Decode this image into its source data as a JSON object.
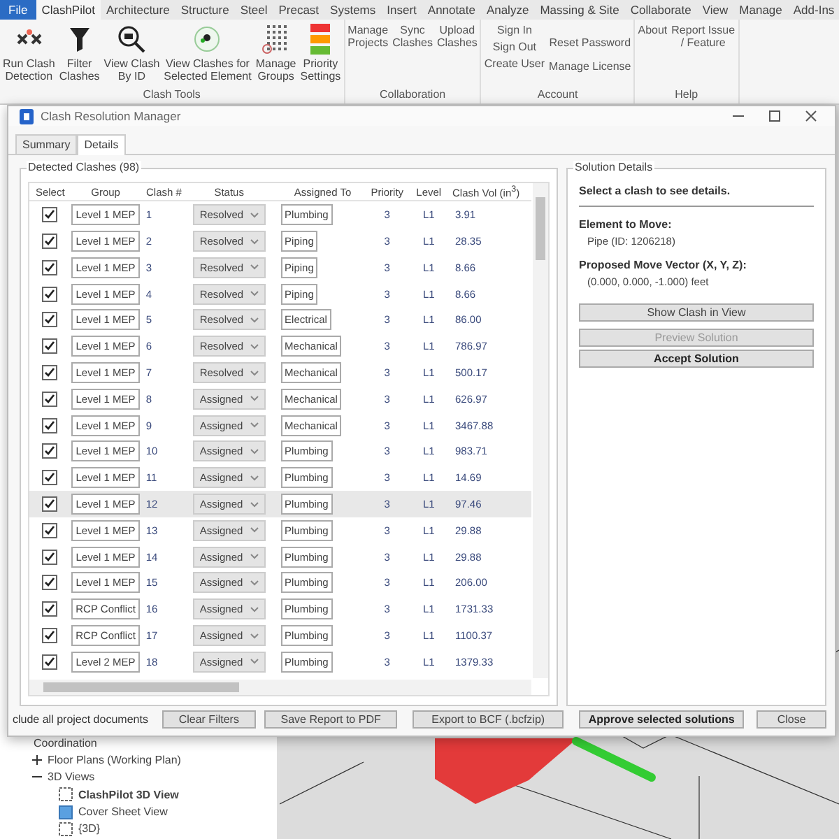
{
  "ribbon": {
    "tabs": [
      {
        "label": "File",
        "kind": "file",
        "selected": false
      },
      {
        "label": "ClashPilot",
        "kind": "tab",
        "selected": true
      },
      {
        "label": "Architecture",
        "kind": "tab",
        "selected": false
      },
      {
        "label": "Structure",
        "kind": "tab",
        "selected": false
      },
      {
        "label": "Steel",
        "kind": "tab",
        "selected": false
      },
      {
        "label": "Precast",
        "kind": "tab",
        "selected": false
      },
      {
        "label": "Systems",
        "kind": "tab",
        "selected": false
      },
      {
        "label": "Insert",
        "kind": "tab",
        "selected": false
      },
      {
        "label": "Annotate",
        "kind": "tab",
        "selected": false
      },
      {
        "label": "Analyze",
        "kind": "tab",
        "selected": false
      },
      {
        "label": "Massing & Site",
        "kind": "tab",
        "selected": false
      },
      {
        "label": "Collaborate",
        "kind": "tab",
        "selected": false
      },
      {
        "label": "View",
        "kind": "tab",
        "selected": false
      },
      {
        "label": "Manage",
        "kind": "tab",
        "selected": false
      },
      {
        "label": "Add-Ins",
        "kind": "tab",
        "selected": false
      }
    ],
    "panels": [
      {
        "title": "Clash Tools",
        "columns": [
          [
            {
              "label": "Run Clash\nDetection",
              "kind": "detect"
            }
          ],
          [
            {
              "label": "Filter\nClashes",
              "kind": "filter"
            }
          ],
          [
            {
              "label": "View Clash\nBy ID",
              "kind": "id"
            }
          ],
          [
            {
              "label": "View Clashes for\nSelected Element",
              "kind": "element"
            }
          ],
          [
            {
              "label": "Manage\nGroups",
              "kind": "groups"
            }
          ],
          [
            {
              "label": "Priority\nSettings",
              "kind": "priority"
            }
          ]
        ]
      },
      {
        "title": "Collaboration",
        "columns": [
          [
            {
              "label": "Manage\nProjects",
              "kind": "text"
            }
          ],
          [
            {
              "label": "Sync\nClashes",
              "kind": "text"
            }
          ],
          [
            {
              "label": "Upload\nClashes",
              "kind": "text"
            }
          ]
        ]
      },
      {
        "title": "Account",
        "columns": [
          [
            {
              "label": "Sign In",
              "kind": "text"
            },
            {
              "label": "Sign Out",
              "kind": "text"
            },
            {
              "label": "Create User",
              "kind": "text"
            }
          ],
          [
            {
              "label": "Reset Password",
              "kind": "text"
            },
            {
              "label": "Manage License",
              "kind": "text"
            }
          ]
        ]
      },
      {
        "title": "Help",
        "columns": [
          [
            {
              "label": "About",
              "kind": "text"
            }
          ],
          [
            {
              "label": "Report Issue\n/ Feature",
              "kind": "text"
            }
          ]
        ]
      }
    ]
  },
  "browser": {
    "items": [
      {
        "label": "Coordination",
        "children": [
          {
            "label": "Floor Plans (Working Plan)",
            "expanded": false
          },
          {
            "label": "3D Views",
            "expanded": true,
            "children": [
              {
                "label": "ClashPilot 3D View",
                "kind": "view",
                "selected": true
              },
              {
                "label": "Cover Sheet View",
                "kind": "sheet",
                "selected": false
              },
              {
                "label": "{3D}",
                "kind": "view",
                "selected": false
              }
            ]
          }
        ]
      }
    ]
  },
  "dialog": {
    "title": "Clash Resolution Manager",
    "tabs": [
      {
        "label": "Summary",
        "selected": false
      },
      {
        "label": "Details",
        "selected": true
      }
    ],
    "clashes": {
      "legend": "Detected Clashes (98)",
      "columns": [
        "Select",
        "Group",
        "Clash #",
        "Status",
        "Assigned To",
        "Priority",
        "Level",
        "Clash Vol (in$^{3}$)"
      ],
      "rows": [
        {
          "checked": true,
          "group": "Level 1 MEP",
          "number": "1",
          "status": "Resolved",
          "assigned_to": "Plumbing",
          "priority": "3",
          "level": "L1",
          "volume": "3.91",
          "selected": false
        },
        {
          "checked": true,
          "group": "Level 1 MEP",
          "number": "2",
          "status": "Resolved",
          "assigned_to": "Piping",
          "priority": "3",
          "level": "L1",
          "volume": "28.35",
          "selected": false
        },
        {
          "checked": true,
          "group": "Level 1 MEP",
          "number": "3",
          "status": "Resolved",
          "assigned_to": "Piping",
          "priority": "3",
          "level": "L1",
          "volume": "8.66",
          "selected": false
        },
        {
          "checked": true,
          "group": "Level 1 MEP",
          "number": "4",
          "status": "Resolved",
          "assigned_to": "Piping",
          "priority": "3",
          "level": "L1",
          "volume": "8.66",
          "selected": false
        },
        {
          "checked": true,
          "group": "Level 1 MEP",
          "number": "5",
          "status": "Resolved",
          "assigned_to": "Electrical",
          "priority": "3",
          "level": "L1",
          "volume": "86.00",
          "selected": false
        },
        {
          "checked": true,
          "group": "Level 1 MEP",
          "number": "6",
          "status": "Resolved",
          "assigned_to": "Mechanical",
          "priority": "3",
          "level": "L1",
          "volume": "786.97",
          "selected": false
        },
        {
          "checked": true,
          "group": "Level 1 MEP",
          "number": "7",
          "status": "Resolved",
          "assigned_to": "Mechanical",
          "priority": "3",
          "level": "L1",
          "volume": "500.17",
          "selected": false
        },
        {
          "checked": true,
          "group": "Level 1 MEP",
          "number": "8",
          "status": "Assigned",
          "assigned_to": "Mechanical",
          "priority": "3",
          "level": "L1",
          "volume": "626.97",
          "selected": false
        },
        {
          "checked": true,
          "group": "Level 1 MEP",
          "number": "9",
          "status": "Assigned",
          "assigned_to": "Mechanical",
          "priority": "3",
          "level": "L1",
          "volume": "3467.88",
          "selected": false
        },
        {
          "checked": true,
          "group": "Level 1 MEP",
          "number": "10",
          "status": "Assigned",
          "assigned_to": "Plumbing",
          "priority": "3",
          "level": "L1",
          "volume": "983.71",
          "selected": false
        },
        {
          "checked": true,
          "group": "Level 1 MEP",
          "number": "11",
          "status": "Assigned",
          "assigned_to": "Plumbing",
          "priority": "3",
          "level": "L1",
          "volume": "14.69",
          "selected": false
        },
        {
          "checked": true,
          "group": "Level 1 MEP",
          "number": "12",
          "status": "Assigned",
          "assigned_to": "Plumbing",
          "priority": "3",
          "level": "L1",
          "volume": "97.46",
          "selected": true
        },
        {
          "checked": true,
          "group": "Level 1 MEP",
          "number": "13",
          "status": "Assigned",
          "assigned_to": "Plumbing",
          "priority": "3",
          "level": "L1",
          "volume": "29.88",
          "selected": false
        },
        {
          "checked": true,
          "group": "Level 1 MEP",
          "number": "14",
          "status": "Assigned",
          "assigned_to": "Plumbing",
          "priority": "3",
          "level": "L1",
          "volume": "29.88",
          "selected": false
        },
        {
          "checked": true,
          "group": "Level 1 MEP",
          "number": "15",
          "status": "Assigned",
          "assigned_to": "Plumbing",
          "priority": "3",
          "level": "L1",
          "volume": "206.00",
          "selected": false
        },
        {
          "checked": true,
          "group": "RCP Conflict",
          "number": "16",
          "status": "Assigned",
          "assigned_to": "Plumbing",
          "priority": "3",
          "level": "L1",
          "volume": "1731.33",
          "selected": false
        },
        {
          "checked": true,
          "group": "RCP Conflict",
          "number": "17",
          "status": "Assigned",
          "assigned_to": "Plumbing",
          "priority": "3",
          "level": "L1",
          "volume": "1100.37",
          "selected": false
        },
        {
          "checked": true,
          "group": "Level 2 MEP",
          "number": "18",
          "status": "Assigned",
          "assigned_to": "Plumbing",
          "priority": "3",
          "level": "L1",
          "volume": "1379.33",
          "selected": false
        }
      ]
    },
    "solution": {
      "legend": "Solution Details",
      "prompt": "Select a clash to see details.",
      "element_label": "Element to Move:",
      "element_value": "Pipe (ID: 1206218)",
      "vector_label": "Proposed Move Vector (X, Y, Z):",
      "vector_value": "(0.000, 0.000, -1.000) feet",
      "buttons": [
        {
          "label": "Show Clash in View",
          "kind": "normal",
          "disabled": false
        },
        {
          "label": "Preview Solution",
          "kind": "normal",
          "disabled": true
        },
        {
          "label": "Accept Solution",
          "kind": "strong",
          "disabled": false
        }
      ]
    },
    "footer": {
      "option_text": "clude all project documents",
      "buttons": [
        {
          "label": "Clear Filters",
          "kind": "normal"
        },
        {
          "label": "Save Report to PDF",
          "kind": "normal"
        },
        {
          "label": "Export to BCF (.bcfzip)",
          "kind": "normal"
        },
        {
          "label": "Approve selected solutions",
          "kind": "strong"
        },
        {
          "label": "Close",
          "kind": "normal"
        }
      ]
    }
  }
}
